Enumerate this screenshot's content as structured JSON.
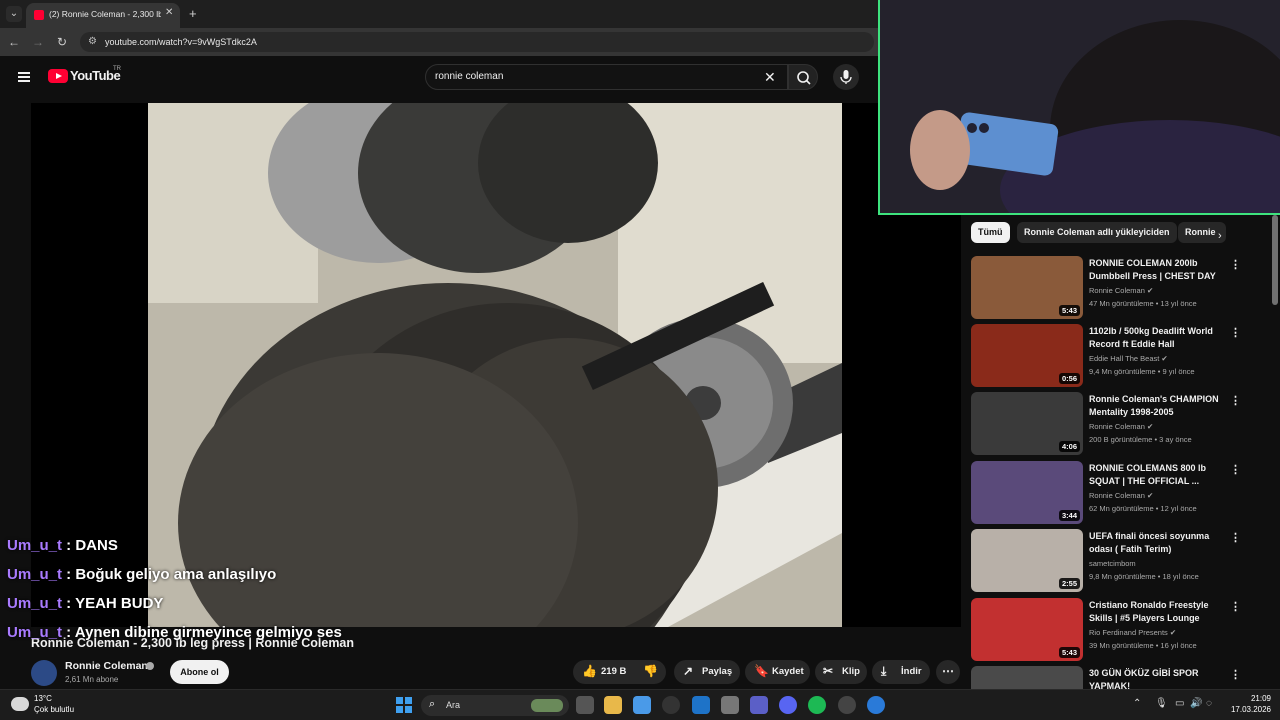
{
  "browser": {
    "tab_title": "(2) Ronnie Coleman - 2,300 lb l",
    "tab_close": "✕",
    "new_tab": "+",
    "url": "youtube.com/watch?v=9vWgSTdkc2A"
  },
  "yt": {
    "logo": "YouTube",
    "region": "TR",
    "search_value": "ronnie coleman"
  },
  "chat": [
    {
      "user": "Um_u_t",
      "msg": " : DANS"
    },
    {
      "user": "Um_u_t",
      "msg": " : Boğuk geliyo ama anlaşılıyo"
    },
    {
      "user": "Um_u_t",
      "msg": " : YEAH BUDY"
    },
    {
      "user": "Um_u_t",
      "msg": " : Aynen dibine girmeyince gelmiyo ses"
    }
  ],
  "video": {
    "title": "Ronnie Coleman - 2,300 lb leg press | Ronnie Coleman",
    "channel": "Ronnie Coleman",
    "subscribers": "2,61 Mn abone",
    "subscribe_label": "Abone ol",
    "likes": "219 B",
    "share_label": "Paylaş",
    "save_label": "Kaydet",
    "clip_label": "Klip",
    "download_label": "İndir"
  },
  "chips": [
    "Tümü",
    "Ronnie Coleman adlı yükleyiciden",
    "Ronnie"
  ],
  "recommendations": [
    {
      "title": "RONNIE COLEMAN 200lb Dumbbell Press | CHEST DAY",
      "channel": "Ronnie Coleman",
      "verified": true,
      "meta": "47 Mn görüntüleme • 13 yıl önce",
      "duration": "5:43",
      "thumb_color": "#8a5a3a"
    },
    {
      "title": "1102lb / 500kg Deadlift World Record ft Eddie Hall",
      "channel": "Eddie Hall The Beast",
      "verified": true,
      "meta": "9,4 Mn görüntüleme • 9 yıl önce",
      "duration": "0:56",
      "thumb_color": "#8a2a1a"
    },
    {
      "title": "Ronnie Coleman's CHAMPION Mentality 1998-2005",
      "channel": "Ronnie Coleman",
      "verified": true,
      "meta": "200 B görüntüleme • 3 ay önce",
      "duration": "4:06",
      "thumb_color": "#3a3a3a"
    },
    {
      "title": "RONNIE COLEMANS 800 lb SQUAT | THE OFFICIAL ...",
      "channel": "Ronnie Coleman",
      "verified": true,
      "meta": "62 Mn görüntüleme • 12 yıl önce",
      "duration": "3:44",
      "thumb_color": "#5a4a7a"
    },
    {
      "title": "UEFA finali öncesi soyunma odası ( Fatih Terim)",
      "channel": "sametcimbom",
      "verified": false,
      "meta": "9,8 Mn görüntüleme • 18 yıl önce",
      "duration": "2:55",
      "thumb_color": "#b8b0a8"
    },
    {
      "title": "Cristiano Ronaldo Freestyle Skills | #5 Players Lounge",
      "channel": "Rio Ferdinand Presents",
      "verified": true,
      "meta": "39 Mn görüntüleme • 16 yıl önce",
      "duration": "5:43",
      "thumb_color": "#c23030"
    },
    {
      "title": "30 GÜN ÖKÜZ GİBİ SPOR YAPMAK!",
      "channel": "",
      "verified": false,
      "meta": "",
      "duration": "",
      "thumb_color": "#4a4a4a"
    }
  ],
  "taskbar": {
    "temp": "13°C",
    "weather": "Çok bulutlu",
    "search_placeholder": "Ara",
    "time": "21:09",
    "date": "17.03.2026"
  },
  "colors": {
    "accent_red": "#ff0033",
    "chat_user": "#a97bff",
    "webcam_border": "#3ee37e"
  }
}
